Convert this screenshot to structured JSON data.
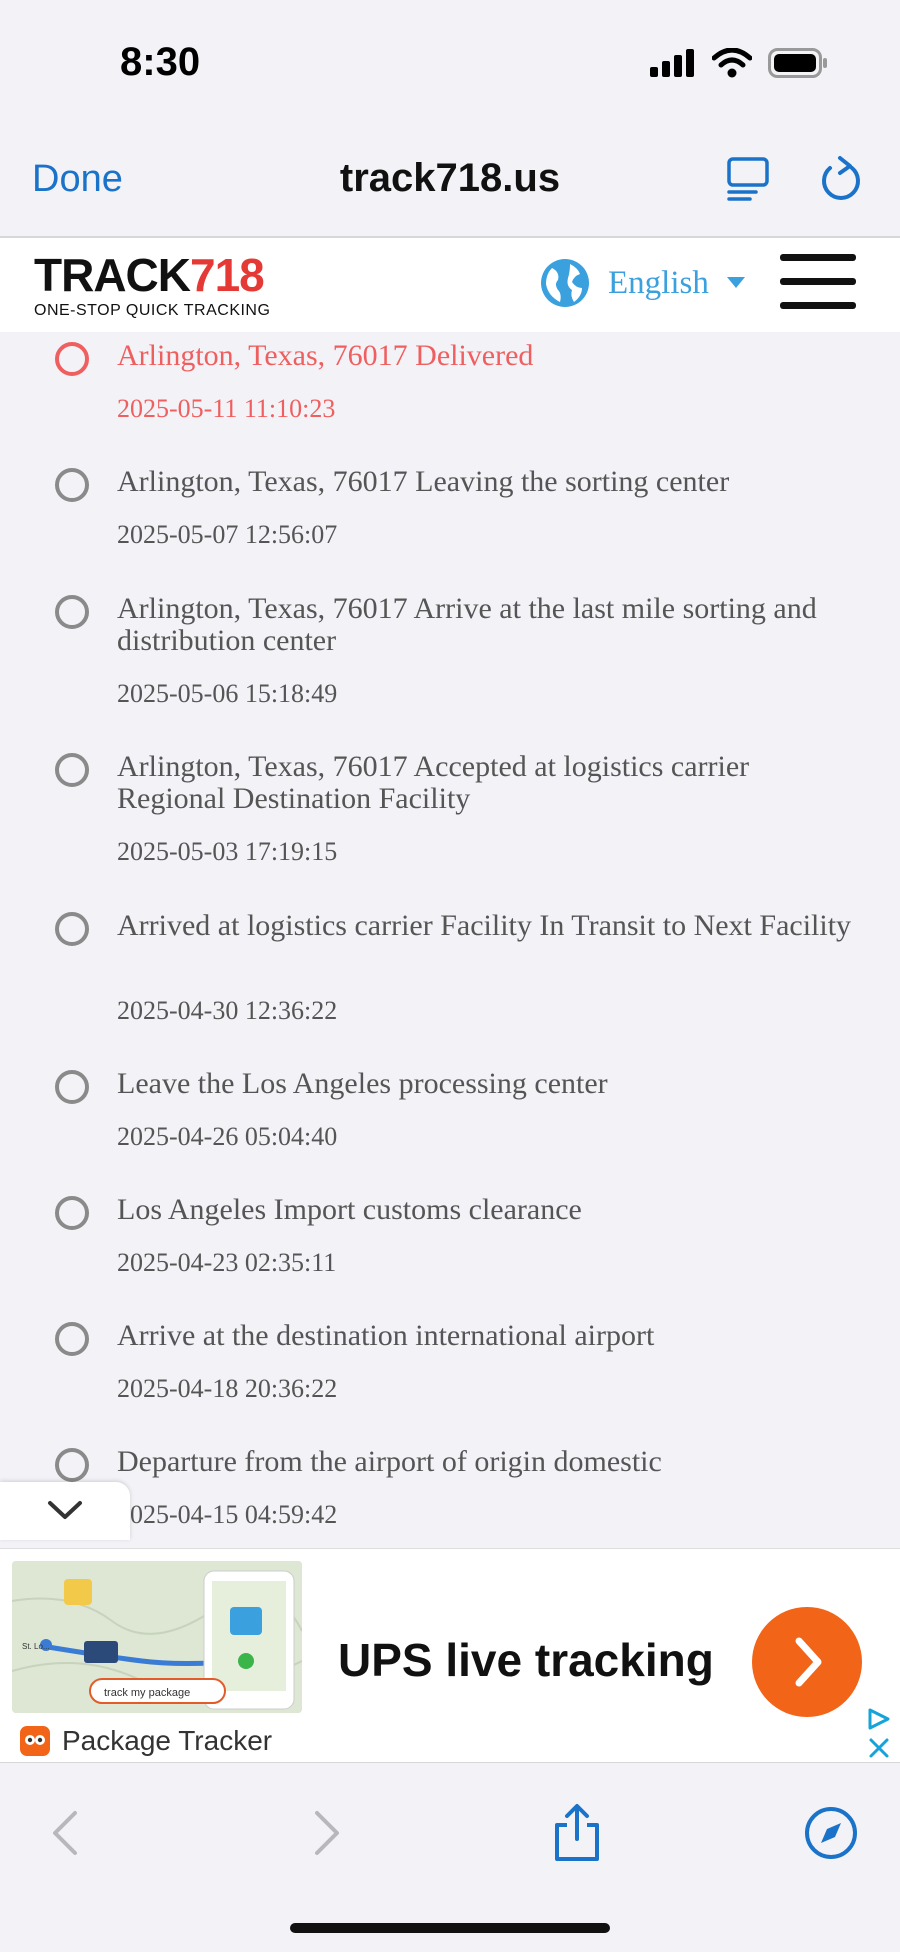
{
  "status_bar": {
    "time": "8:30"
  },
  "browser": {
    "done_label": "Done",
    "url": "track718.us"
  },
  "site": {
    "logo_track": "TRACK",
    "logo_num": "718",
    "logo_tagline": "ONE-STOP QUICK TRACKING",
    "language": "English"
  },
  "events": [
    {
      "title": "Arlington, Texas, 76017 Delivered",
      "time": "2025-05-11 11:10:23",
      "active": true
    },
    {
      "title": "Arlington, Texas, 76017 Leaving the sorting center",
      "time": "2025-05-07 12:56:07"
    },
    {
      "title": "Arlington, Texas, 76017 Arrive at the last mile sorting and distribution center",
      "time": "2025-05-06 15:18:49"
    },
    {
      "title": "Arlington, Texas, 76017 Accepted at logistics carrier Regional Destination Facility",
      "time": "2025-05-03 17:19:15"
    },
    {
      "title": "Arrived at logistics carrier Facility In Transit to Next Facility",
      "time": "2025-04-30 12:36:22"
    },
    {
      "title": "Leave the Los Angeles processing center",
      "time": "2025-04-26 05:04:40"
    },
    {
      "title": "Los Angeles Import customs clearance",
      "time": "2025-04-23 02:35:11"
    },
    {
      "title": "Arrive at the destination international airport",
      "time": "2025-04-18 20:36:22"
    },
    {
      "title": "Departure from the airport of origin domestic",
      "time": "2025-04-15 04:59:42"
    }
  ],
  "ad": {
    "title": "UPS live tracking",
    "brand": "Package Tracker",
    "image_search_label": "track my package",
    "image_place": "St. Lo..."
  },
  "colors": {
    "accent": "#1a73c8",
    "delivered": "#ef5f5f",
    "ad_button": "#f26418",
    "lang": "#3aa0de"
  }
}
